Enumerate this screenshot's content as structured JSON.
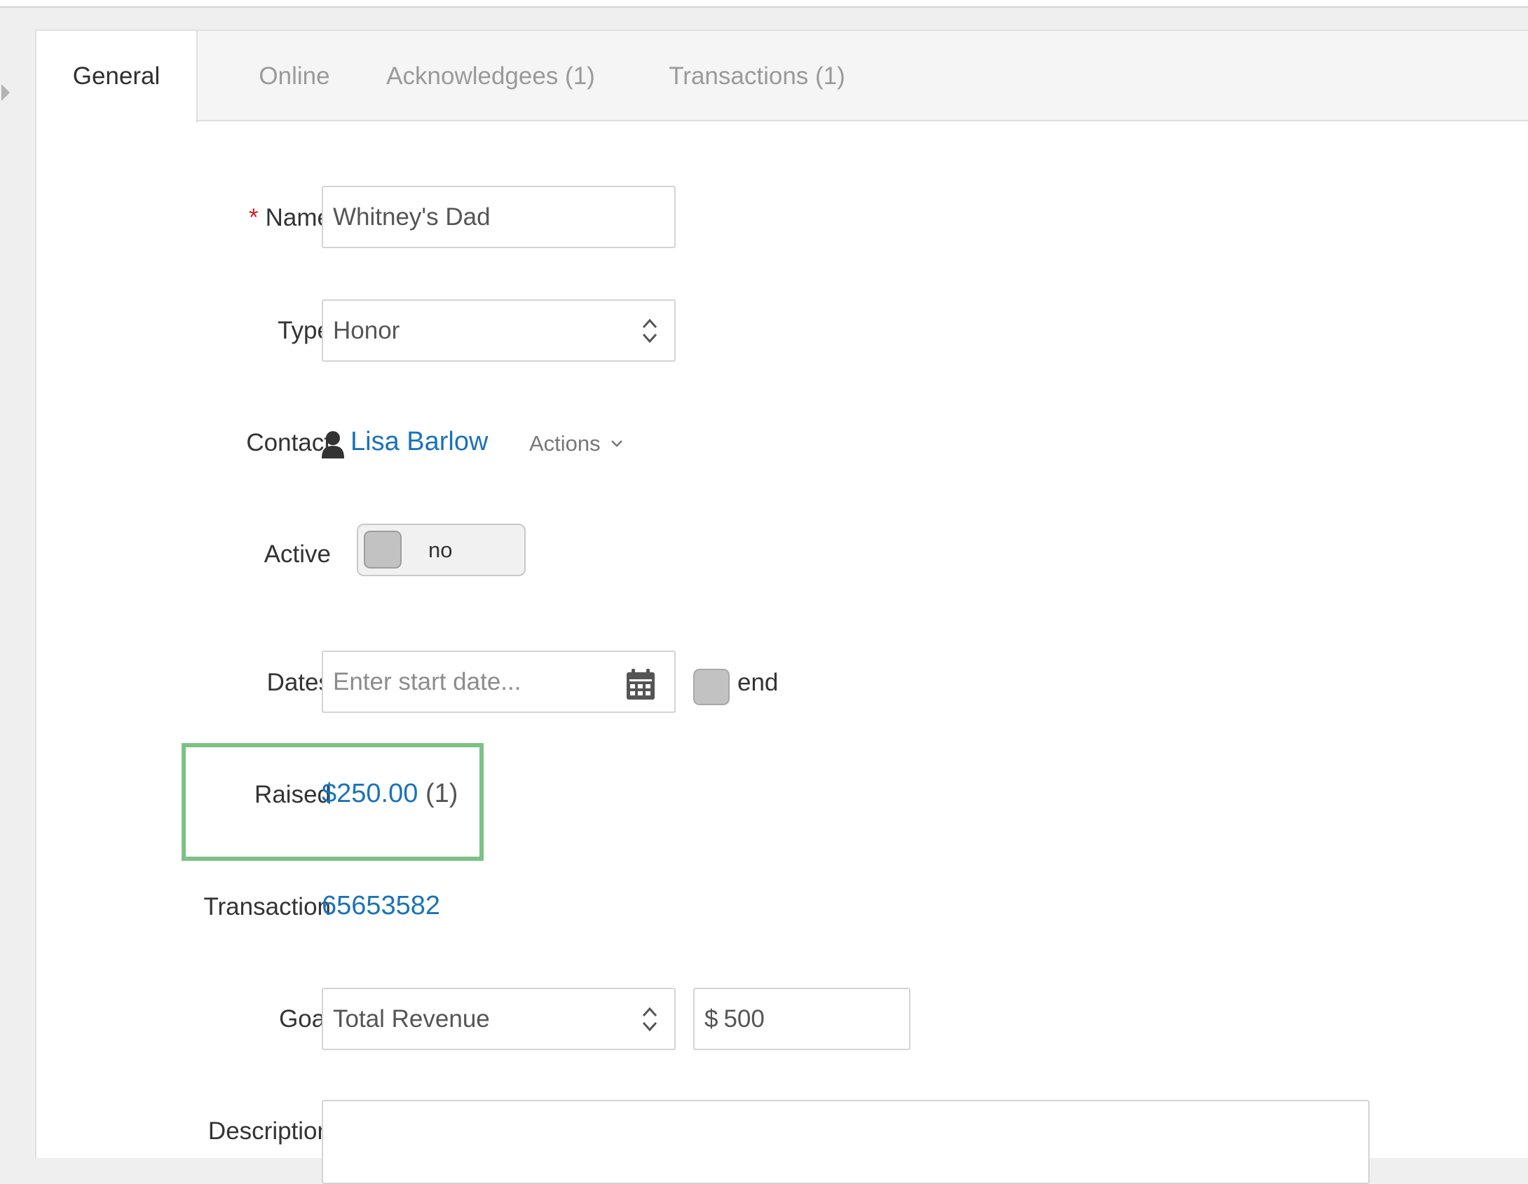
{
  "tabs": [
    {
      "label": "General",
      "active": true
    },
    {
      "label": "Online",
      "active": false
    },
    {
      "label": "Acknowledgees (1)",
      "active": false
    },
    {
      "label": "Transactions (1)",
      "active": false
    }
  ],
  "form": {
    "name": {
      "label": "Name",
      "required_mark": "*",
      "value": "Whitney's Dad"
    },
    "type": {
      "label": "Type",
      "value": "Honor"
    },
    "contact": {
      "label": "Contact",
      "name": "Lisa Barlow",
      "actions_label": "Actions"
    },
    "active": {
      "label": "Active",
      "state_text": "no"
    },
    "dates": {
      "label": "Dates",
      "start_placeholder": "Enter start date...",
      "end_label": "end"
    },
    "raised": {
      "label": "Raised",
      "amount": "$250.00",
      "count": "(1)"
    },
    "transaction": {
      "label": "Transaction",
      "id": "65653582"
    },
    "goal": {
      "label": "Goal",
      "type_value": "Total Revenue",
      "currency_symbol": "$",
      "amount": "500"
    },
    "description": {
      "label": "Description",
      "value": ""
    }
  },
  "colors": {
    "link": "#1a73b8",
    "required": "#d0222c",
    "highlight_border": "#7cc285"
  },
  "icons": {
    "contact": "person-icon",
    "type_select": "up-down-arrows-icon",
    "actions": "chevron-down-icon",
    "calendar": "calendar-icon"
  }
}
